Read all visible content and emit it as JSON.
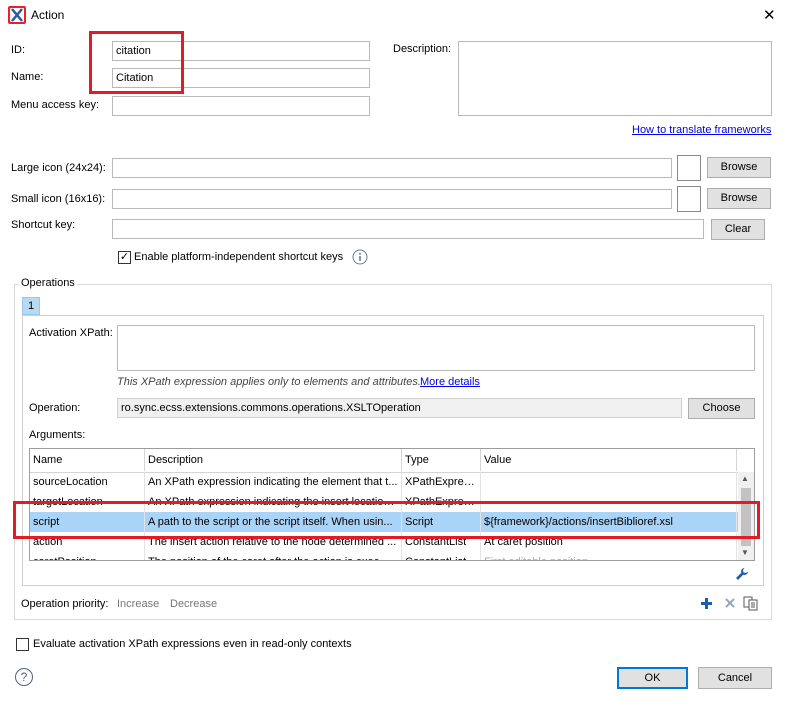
{
  "window": {
    "title": "Action",
    "close": "✕"
  },
  "fields": {
    "id_label": "ID:",
    "id_value": "citation",
    "name_label": "Name:",
    "name_value": "Citation",
    "menu_key_label": "Menu access key:",
    "menu_key_value": "",
    "description_label": "Description:",
    "description_value": "",
    "translate_link": "How to translate frameworks",
    "large_icon_label": "Large icon (24x24):",
    "small_icon_label": "Small icon (16x16):",
    "browse_label": "Browse",
    "shortcut_label": "Shortcut key:",
    "clear_label": "Clear",
    "enable_shortcut_label": "Enable platform-independent shortcut keys"
  },
  "operations": {
    "group_label": "Operations",
    "tab_label": "1",
    "activation_label": "Activation XPath:",
    "activation_value": "",
    "xpath_hint": "This XPath expression applies only to elements and attributes.",
    "more_details": "More details",
    "operation_label": "Operation:",
    "operation_value": "ro.sync.ecss.extensions.commons.operations.XSLTOperation",
    "choose_label": "Choose",
    "arguments_label": "Arguments:",
    "columns": [
      "Name",
      "Description",
      "Type",
      "Value"
    ],
    "rows": [
      {
        "name": "sourceLocation",
        "description": "An XPath expression indicating the element that t...",
        "type": "XPathExpres...",
        "value": ""
      },
      {
        "name": "targetLocation",
        "description": "An XPath expression indicating the insert location...",
        "type": "XPathExpres...",
        "value": ""
      },
      {
        "name": "script",
        "description": "A path to the script or the script itself. When usin...",
        "type": "Script",
        "value": "${framework}/actions/insertBiblioref.xsl"
      },
      {
        "name": "action",
        "description": "The insert action relative to the node determined ...",
        "type": "ConstantList",
        "value": "At caret position"
      },
      {
        "name": "caretPosition",
        "description": "The position of the caret after the action is exec...",
        "type": "ConstantList",
        "value": "First editable position"
      }
    ],
    "priority_label": "Operation priority:",
    "increase_label": "Increase",
    "decrease_label": "Decrease"
  },
  "footer": {
    "evaluate_label": "Evaluate activation XPath expressions even in read-only contexts",
    "ok_label": "OK",
    "cancel_label": "Cancel",
    "help": "?"
  }
}
